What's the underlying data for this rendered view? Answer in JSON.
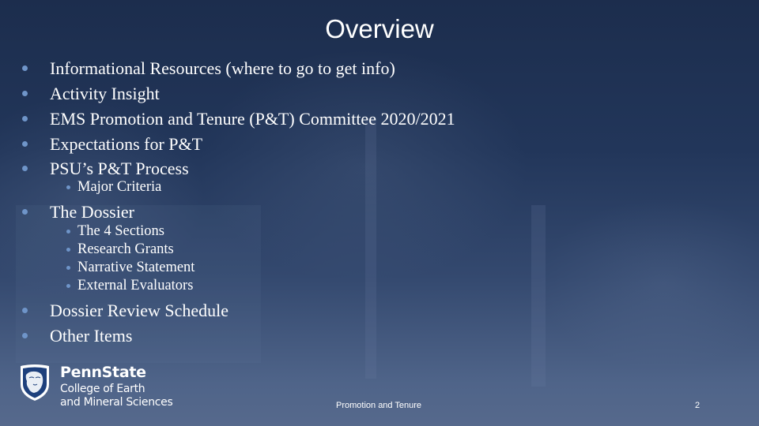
{
  "slide": {
    "title": "Overview",
    "outline": [
      {
        "level": 1,
        "text": "Informational Resources (where to go to get info)"
      },
      {
        "level": 1,
        "text": "Activity Insight"
      },
      {
        "level": 1,
        "text": "EMS Promotion and Tenure (P&T) Committee 2020/2021"
      },
      {
        "level": 1,
        "text": "Expectations for P&T"
      },
      {
        "level": 1,
        "text": "PSU’s P&T Process"
      },
      {
        "level": 2,
        "text": "Major Criteria"
      },
      {
        "level": 1,
        "text": "The Dossier"
      },
      {
        "level": 2,
        "text": "The 4 Sections"
      },
      {
        "level": 2,
        "text": "Research Grants"
      },
      {
        "level": 2,
        "text": "Narrative Statement"
      },
      {
        "level": 2,
        "text": "External Evaluators"
      },
      {
        "level": 1,
        "text": "Dossier Review Schedule"
      },
      {
        "level": 1,
        "text": "Other Items"
      }
    ]
  },
  "logo": {
    "name": "PennState",
    "line1": "College of Earth",
    "line2": "and Mineral Sciences",
    "icon": "nittany-lion-shield-icon"
  },
  "footer": {
    "center_text": "Promotion and Tenure",
    "page_number": "2"
  },
  "colors": {
    "bullet": "#6f95c9",
    "text": "#ffffff",
    "background_top": "#1c2d4d",
    "background_bottom": "#56698c",
    "shield": "#1e407c"
  }
}
